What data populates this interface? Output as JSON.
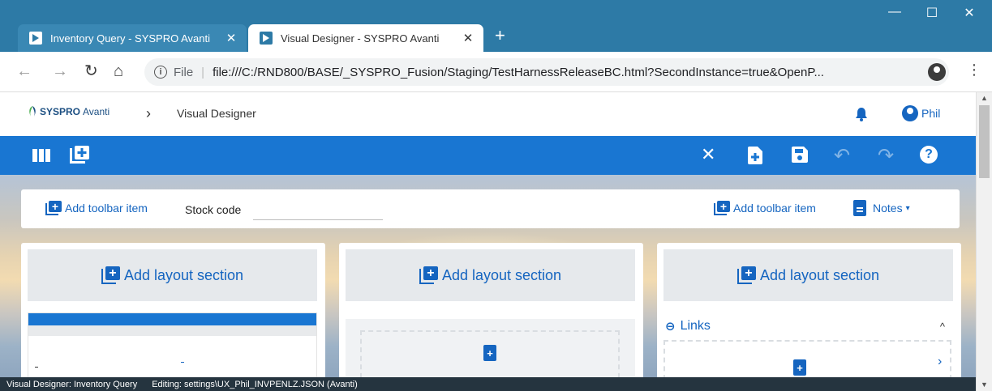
{
  "browser": {
    "tabs": [
      {
        "title": "Inventory Query - SYSPRO Avanti",
        "active": false
      },
      {
        "title": "Visual Designer - SYSPRO Avanti",
        "active": true
      }
    ],
    "close_glyph": "✕",
    "new_tab_glyph": "+",
    "window_controls": {
      "minimize": "—",
      "maximize": "☐",
      "close": "✕"
    },
    "nav": {
      "back": "←",
      "forward": "→",
      "reload": "↻",
      "home": "⌂"
    },
    "address": {
      "scheme": "File",
      "separator": "|",
      "url": "file:///C:/RND800/BASE/_SYSPRO_Fusion/Staging/TestHarnessReleaseBC.html?SecondInstance=true&OpenP..."
    },
    "bookmark_glyph": "☆",
    "menu_glyph": "⋮"
  },
  "app": {
    "logo": {
      "part1": "SYSPRO",
      "part2": "Avanti"
    },
    "breadcrumb_separator": "›",
    "breadcrumb": "Visual Designer",
    "user": "Phil",
    "icons": [
      "bell-icon",
      "user-icon"
    ]
  },
  "toolbar": {
    "left_icons": [
      "columns-icon",
      "add-panel-icon"
    ],
    "right_glyphs": {
      "close": "✕",
      "redo": "↷",
      "undo": "↶",
      "help": "?"
    }
  },
  "designer": {
    "toolbar_card": {
      "add_item_label_left": "Add toolbar item",
      "stock_code_label": "Stock code",
      "stock_code_value": "",
      "add_item_label_right": "Add toolbar item",
      "notes_label": "Notes",
      "notes_caret": "▾"
    },
    "columns": [
      {
        "add_section_label": "Add layout section"
      },
      {
        "add_section_label": "Add layout section"
      },
      {
        "add_section_label": "Add layout section"
      }
    ],
    "links": {
      "label": "Links",
      "collapse_glyph": "^",
      "next_glyph": "›"
    },
    "add_glyph": "+"
  },
  "status": {
    "left": "Visual Designer: Inventory Query",
    "right": "Editing: settings\\UX_Phil_INVPENLZ.JSON  (Avanti)"
  },
  "colors": {
    "chrome_titlebar": "#2d7aa6",
    "toolbar_blue": "#1976d2",
    "link_blue": "#1565c0",
    "statusbar": "#25343f"
  }
}
